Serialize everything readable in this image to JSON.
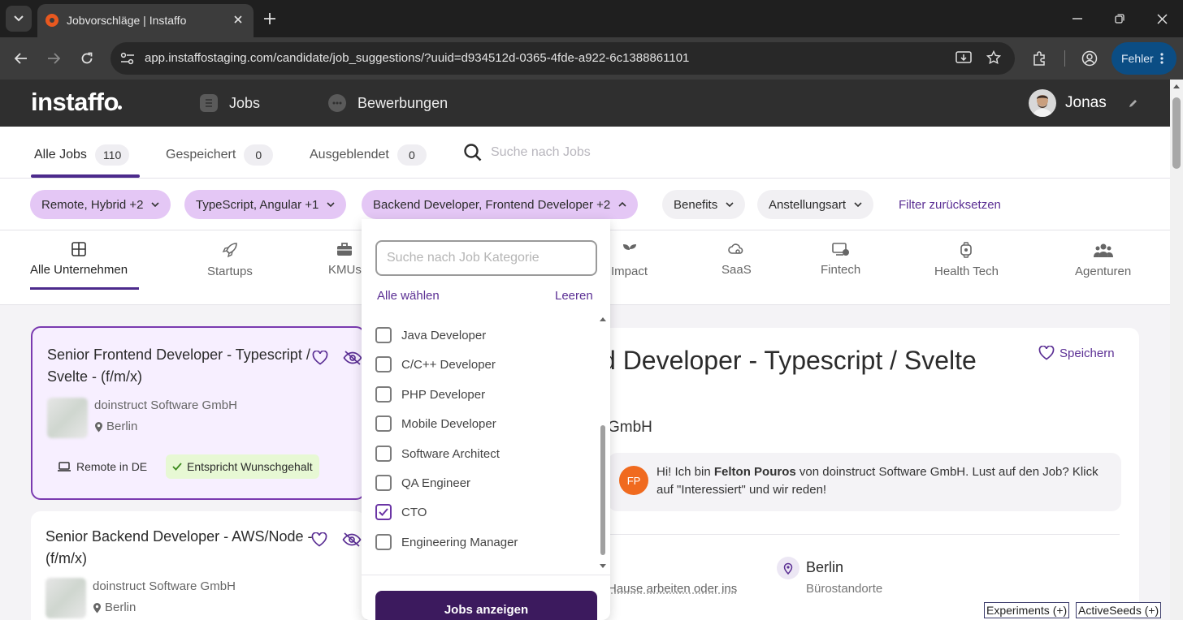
{
  "browser": {
    "tab_title": "Jobvorschläge | Instaffo",
    "url": "app.instaffostaging.com/candidate/job_suggestions/?uuid=d934512d-0365-4fde-a922-6c1388861101",
    "profile_status": "Fehler"
  },
  "header": {
    "logo": "instaffo",
    "nav": [
      {
        "label": "Jobs",
        "icon": "document-icon"
      },
      {
        "label": "Bewerbungen",
        "icon": "chat-bubble-icon"
      }
    ],
    "user_name": "Jonas"
  },
  "job_tabs": [
    {
      "label": "Alle Jobs",
      "count": "110",
      "active": true
    },
    {
      "label": "Gespeichert",
      "count": "0"
    },
    {
      "label": "Ausgeblendet",
      "count": "0"
    }
  ],
  "search": {
    "placeholder": "Suche nach Jobs"
  },
  "filters": [
    {
      "label": "Remote, Hybrid +2",
      "active": true
    },
    {
      "label": "TypeScript, Angular +1",
      "active": true
    },
    {
      "label": "Backend Developer, Frontend Developer +2",
      "active": true,
      "open": true
    },
    {
      "label": "Benefits",
      "active": false
    },
    {
      "label": "Anstellungsart",
      "active": false
    }
  ],
  "reset_filters_label": "Filter zurücksetzen",
  "categories": [
    {
      "label": "Alle Unternehmen",
      "icon": "grid-icon",
      "active": true
    },
    {
      "label": "Startups",
      "icon": "rocket-icon"
    },
    {
      "label": "KMUs",
      "icon": "briefcase-icon"
    },
    {
      "label": "Impact",
      "icon": "sprout-icon"
    },
    {
      "label": "SaaS",
      "icon": "cloud-gear-icon"
    },
    {
      "label": "Fintech",
      "icon": "monitor-coin-icon"
    },
    {
      "label": "Health Tech",
      "icon": "smartwatch-icon"
    },
    {
      "label": "Agenturen",
      "icon": "people-icon"
    }
  ],
  "jobs": [
    {
      "title": "Senior Frontend Developer - Typescript / Svelte - (f/m/x)",
      "company": "doinstruct Software GmbH",
      "location": "Berlin",
      "remote_label": "Remote in DE",
      "salary_badge": "Entspricht Wunschgehalt"
    },
    {
      "title": "Senior Backend Developer - AWS/Node - (f/m/x)",
      "company": "doinstruct Software GmbH",
      "location": "Berlin"
    }
  ],
  "detail": {
    "title_visible": "d Developer - Typescript / Svelte",
    "save_label": "Speichern",
    "company_visible": "GmbH",
    "recruiter_initials": "FP",
    "message": {
      "pre": "Hi! Ich bin ",
      "name": "Felton Pouros",
      "post": " von doinstruct Software GmbH. Lust auf den Job? Klick auf \"Interessiert\" und wir reden!"
    },
    "work_text_visible": "Hause arbeiten oder ins",
    "city": "Berlin",
    "city_sub": "Bürostandorte"
  },
  "dropdown": {
    "search_placeholder": "Suche nach Job Kategorie",
    "select_all": "Alle wählen",
    "clear": "Leeren",
    "options": [
      {
        "label": "Java Developer",
        "checked": false
      },
      {
        "label": "C/C++ Developer",
        "checked": false
      },
      {
        "label": "PHP Developer",
        "checked": false
      },
      {
        "label": "Mobile Developer",
        "checked": false
      },
      {
        "label": "Software Architect",
        "checked": false
      },
      {
        "label": "QA Engineer",
        "checked": false
      },
      {
        "label": "CTO",
        "checked": true
      },
      {
        "label": "Engineering Manager",
        "checked": false
      }
    ],
    "submit_label": "Jobs anzeigen"
  },
  "debug": {
    "experiments": "Experiments (+)",
    "active_seeds": "ActiveSeeds (+)"
  },
  "colors": {
    "brand_purple": "#4c2a8c",
    "chip_active": "#e4c7f5",
    "button_dark": "#3c1a5e",
    "recruiter_orange": "#f06a1f"
  }
}
